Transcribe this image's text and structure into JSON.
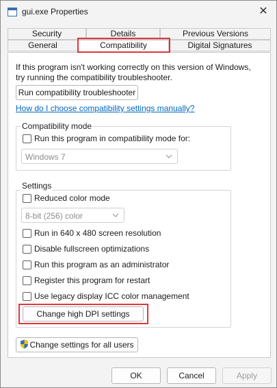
{
  "window": {
    "title": "gui.exe Properties",
    "close_glyph": "✕"
  },
  "tabs": {
    "row_back": [
      "Security",
      "Details",
      "Previous Versions"
    ],
    "row_front": [
      "General",
      "Compatibility",
      "Digital Signatures"
    ],
    "selected": "Compatibility"
  },
  "intro": {
    "text": "If this program isn't working correctly on this version of Windows, try running the compatibility troubleshooter."
  },
  "troubleshooter_button": "Run compatibility troubleshooter",
  "help_link": "How do I choose compatibility settings manually?",
  "compat_mode": {
    "group_label": "Compatibility mode",
    "checkbox_label": "Run this program in compatibility mode for:",
    "checked": false,
    "select_value": "Windows 7"
  },
  "settings": {
    "group_label": "Settings",
    "reduced_color": {
      "label": "Reduced color mode",
      "checked": false
    },
    "color_select_value": "8-bit (256) color",
    "options": [
      {
        "label": "Run in 640 x 480 screen resolution",
        "checked": false
      },
      {
        "label": "Disable fullscreen optimizations",
        "checked": false
      },
      {
        "label": "Run this program as an administrator",
        "checked": false
      },
      {
        "label": "Register this program for restart",
        "checked": false
      },
      {
        "label": "Use legacy display ICC color management",
        "checked": false
      }
    ],
    "dpi_button": "Change high DPI settings"
  },
  "all_users_button": "Change settings for all users",
  "footer": {
    "ok": "OK",
    "cancel": "Cancel",
    "apply": "Apply"
  },
  "colors": {
    "highlight": "#e0353d",
    "link": "#0067c0",
    "shield_blue": "#2a6ec8",
    "shield_yellow": "#f2c200"
  },
  "icons": {
    "app": "app-window-icon",
    "close": "close-icon",
    "dropdown": "chevron-down-icon",
    "admin": "uac-shield-icon"
  }
}
